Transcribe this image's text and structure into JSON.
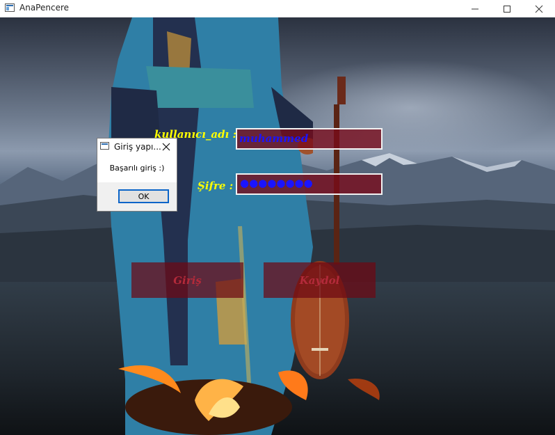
{
  "window": {
    "title": "AnaPencere",
    "controls": [
      "minimize-icon",
      "maximize-icon",
      "close-icon"
    ]
  },
  "form": {
    "username_label": "kullanıcı_adı :",
    "username_value": "muhammed",
    "password_label": "Şifre :",
    "password_masked": "●●●●●●●●",
    "login_button": "Giriş",
    "register_button": "Kaydol"
  },
  "dialog": {
    "title": "Giriş yapı...",
    "message": "Başarılı giriş :)",
    "ok_label": "OK"
  },
  "colors": {
    "label": "#ffff00",
    "field_text": "#1a14ff",
    "field_bg": "#780a19",
    "button_text": "#b32a3a"
  }
}
